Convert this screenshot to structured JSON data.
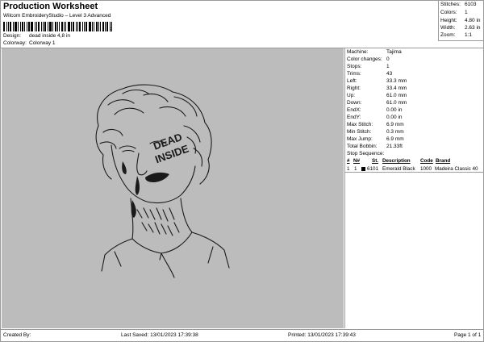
{
  "header": {
    "title": "Production Worksheet",
    "subtitle": "Wilcom EmbroideryStudio – Level 3 Advanced",
    "barcode_suffix": "3"
  },
  "design_meta": [
    {
      "label": "Design:",
      "value": "dead inside 4,8 in"
    },
    {
      "label": "Colorway:",
      "value": "Colorway 1"
    }
  ],
  "summary": [
    {
      "label": "Stitches:",
      "value": "6103"
    },
    {
      "label": "Colors:",
      "value": "1"
    },
    {
      "label": "Height:",
      "value": "4.80 in"
    },
    {
      "label": "Width:",
      "value": "2.63 in"
    },
    {
      "label": "Zoom:",
      "value": "1:1"
    }
  ],
  "design_preview": {
    "background": "#bcbcbc",
    "text_on_face": [
      "DEAD",
      "INSIDE"
    ]
  },
  "machine_info": [
    {
      "label": "Machine:",
      "value": "Tajima"
    },
    {
      "label": "Color changes:",
      "value": "0"
    },
    {
      "label": "Stops:",
      "value": "1"
    },
    {
      "label": "Trims:",
      "value": "43"
    },
    {
      "label": "Left:",
      "value": "33.3 mm"
    },
    {
      "label": "Right:",
      "value": "33.4 mm"
    },
    {
      "label": "Up:",
      "value": "61.0 mm"
    },
    {
      "label": "Down:",
      "value": "61.0 mm"
    },
    {
      "label": "EndX:",
      "value": "0.00 in"
    },
    {
      "label": "EndY:",
      "value": "0.00 in"
    },
    {
      "label": "Max Stitch:",
      "value": "6.9 mm"
    },
    {
      "label": "Min Stitch:",
      "value": "0.3 mm"
    },
    {
      "label": "Max Jump:",
      "value": "6.9 mm"
    },
    {
      "label": "Total Bobbin:",
      "value": "21.33ft"
    }
  ],
  "stop_sequence": {
    "title": "Stop Sequence:",
    "columns": [
      "#",
      "N#",
      "St.",
      "Description",
      "Code",
      "Brand"
    ],
    "rows": [
      {
        "num": "1",
        "n": "1",
        "stitches": "6101",
        "description": "Emerald Black",
        "code": "1000",
        "brand": "Madeira Classic 40",
        "color": "#000000"
      }
    ]
  },
  "footer": {
    "created_by": "Created By:",
    "last_saved": "Last Saved: 13/01/2023 17:39:38",
    "printed": "Printed: 13/01/2023 17:39:43",
    "page": "Page 1 of 1"
  }
}
